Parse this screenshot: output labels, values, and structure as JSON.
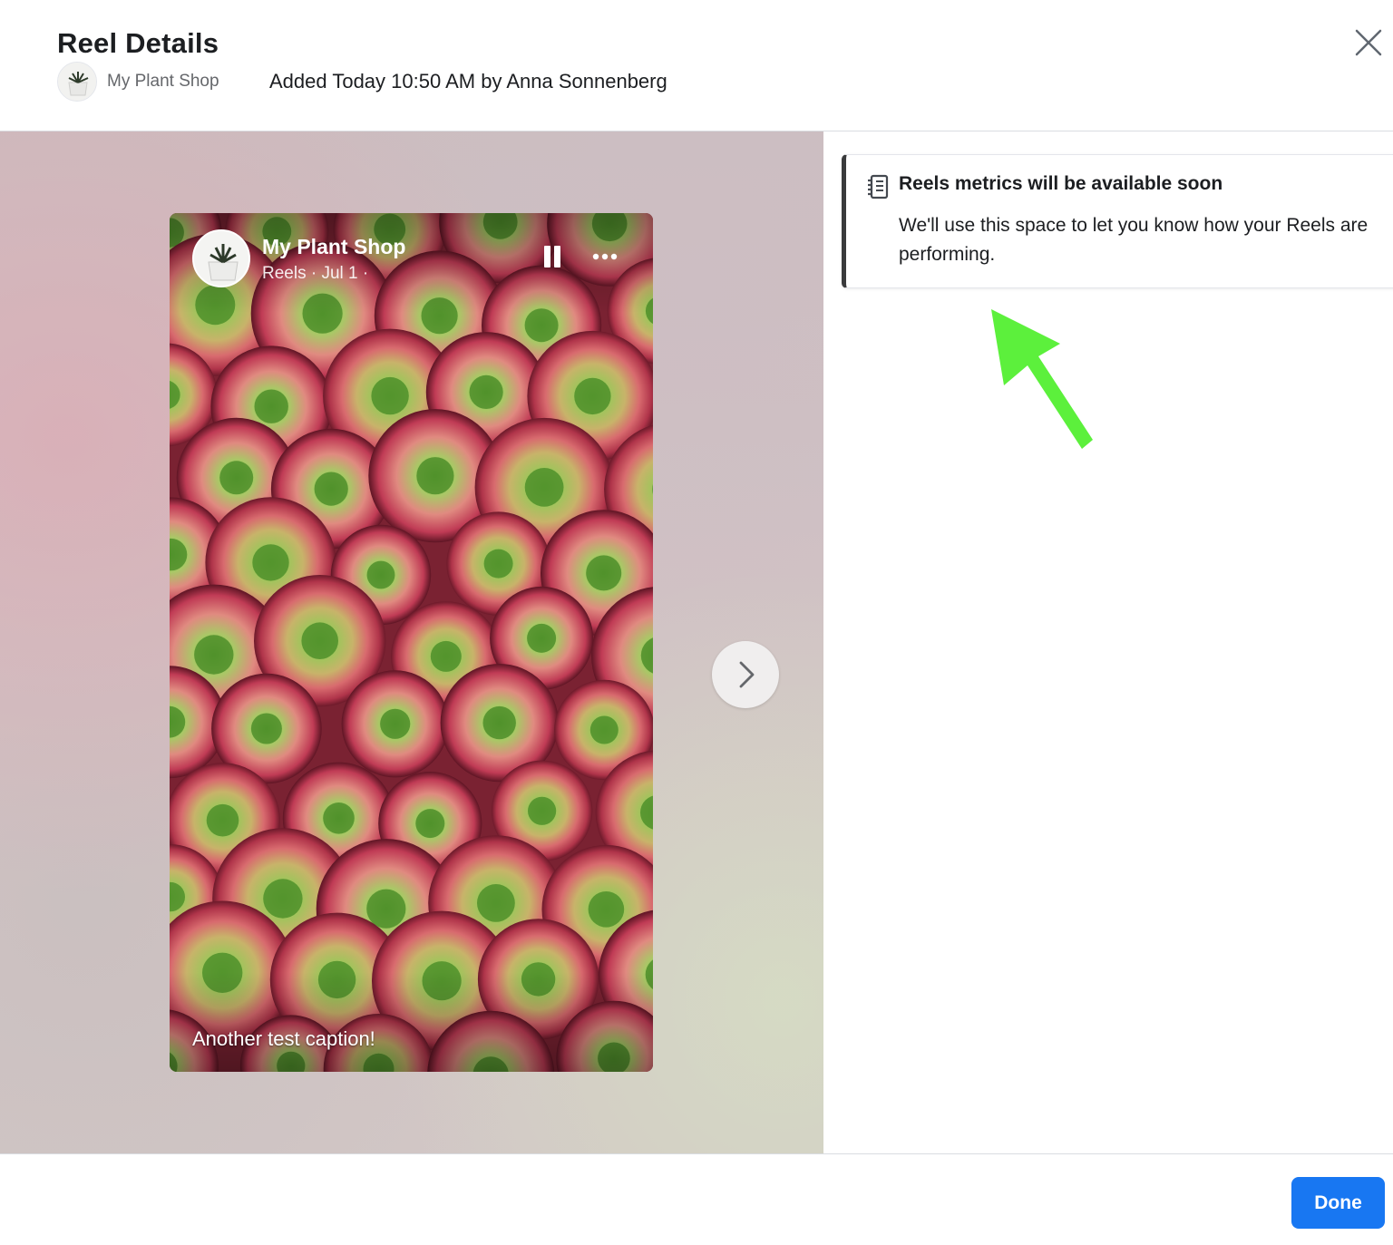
{
  "header": {
    "title": "Reel Details",
    "page_name": "My Plant Shop",
    "added_text": "Added Today 10:50 AM by Anna Sonnenberg",
    "close_icon": "close-icon"
  },
  "reel": {
    "page_name": "My Plant Shop",
    "meta": "Reels · Jul 1 ·",
    "caption": "Another test caption!",
    "pause_icon": "pause-icon",
    "more_icon": "more-options-icon",
    "next_icon": "chevron-right-icon"
  },
  "notice": {
    "icon": "notebook-icon",
    "title": "Reels metrics will be available soon",
    "body": "We'll use this space to let you know how your Reels are performing."
  },
  "footer": {
    "done_label": "Done"
  },
  "colors": {
    "primary": "#1877f2",
    "annotation_arrow": "#5cf03c",
    "notice_border": "#3a3b3c"
  }
}
